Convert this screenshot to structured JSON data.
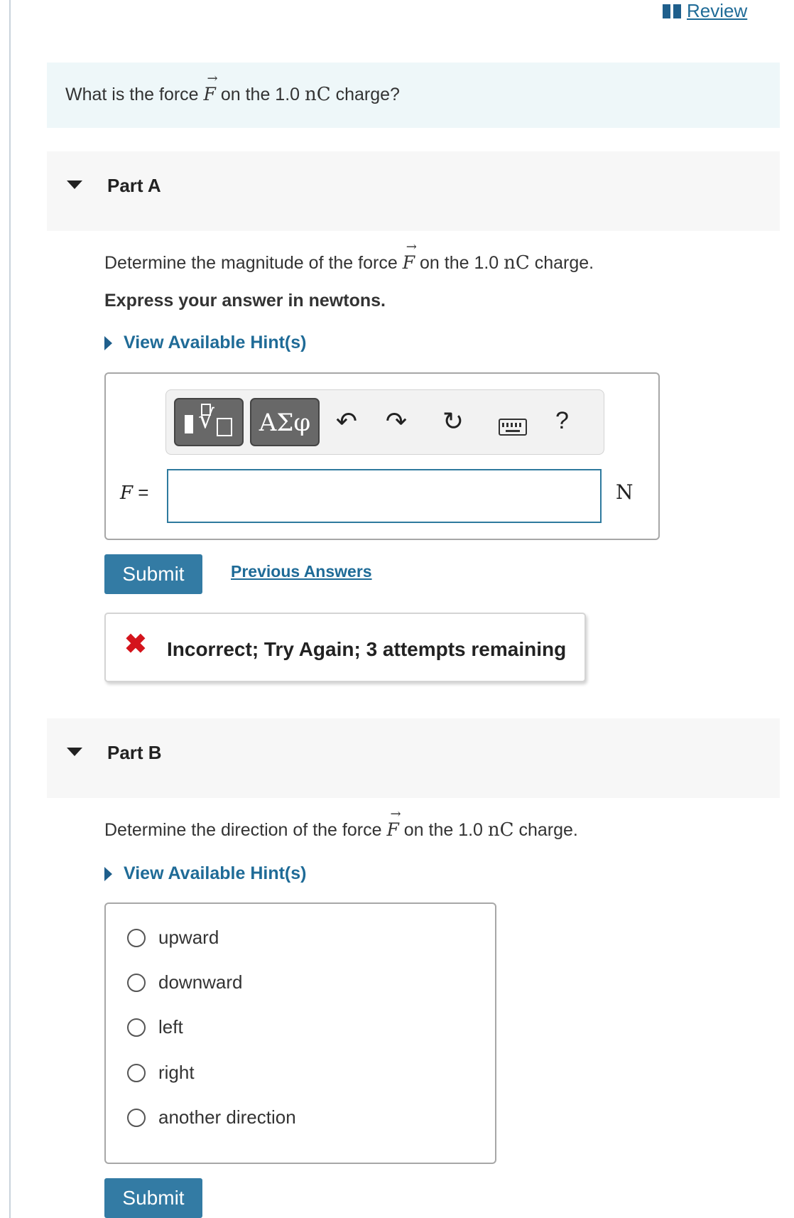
{
  "header": {
    "review_label": "Review"
  },
  "question": {
    "text_before": "What is the force ",
    "symbol": "F",
    "vec_arrow": "→",
    "text_mid": " on the 1.0 ",
    "unit": "nC",
    "text_after": " charge?"
  },
  "part_a": {
    "title": "Part A",
    "prompt_before": "Determine the magnitude of the force ",
    "prompt_symbol": "F",
    "prompt_mid": " on the 1.0 ",
    "prompt_unit": "nC",
    "prompt_after": " charge.",
    "instruction": "Express your answer in newtons.",
    "hint_label": "View Available Hint(s)",
    "toolbar": {
      "templates_button": "templates",
      "greek_label": "ΑΣφ",
      "undo_glyph": "↶",
      "redo_glyph": "↷",
      "reset_glyph": "↻",
      "help_label": "?"
    },
    "answer_var": "F",
    "answer_eq": " =",
    "answer_value": "",
    "answer_unit": "N",
    "submit_label": "Submit",
    "previous_answers_label": "Previous Answers",
    "feedback_icon": "✖",
    "feedback_text": "Incorrect; Try Again; 3 attempts remaining"
  },
  "part_b": {
    "title": "Part B",
    "prompt_before": "Determine the direction of the force ",
    "prompt_symbol": "F",
    "prompt_mid": " on the 1.0 ",
    "prompt_unit": "nC",
    "prompt_after": " charge.",
    "hint_label": "View Available Hint(s)",
    "options": [
      "upward",
      "downward",
      "left",
      "right",
      "another direction"
    ],
    "submit_label": "Submit"
  },
  "colors": {
    "link": "#1f6b97",
    "button": "#337ba4",
    "error": "#d4141c",
    "question_bg": "#eef7f9"
  }
}
